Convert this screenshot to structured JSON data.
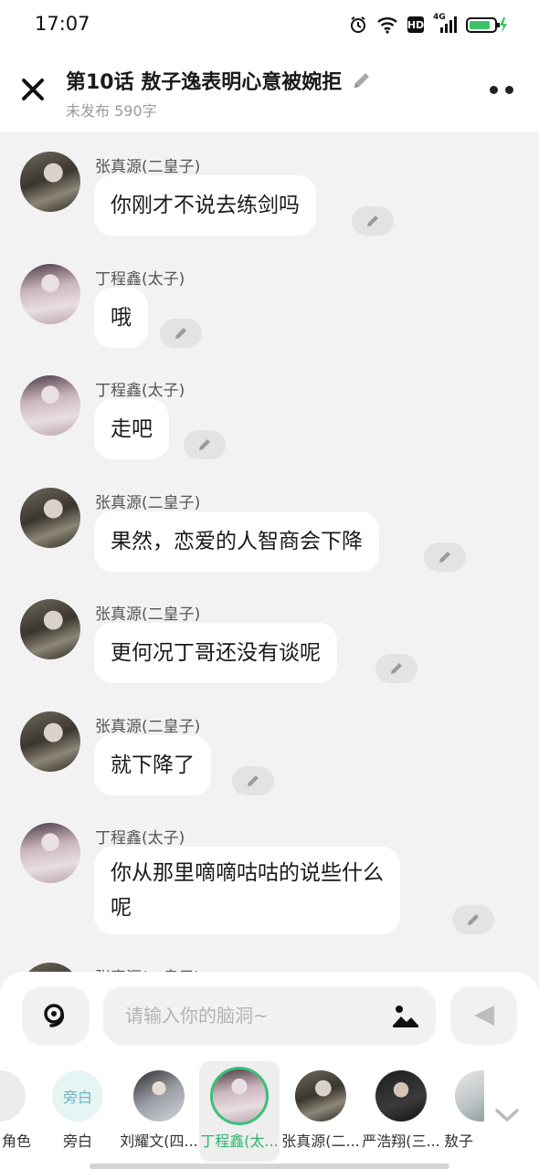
{
  "status_bar": {
    "time": "17:07",
    "network_label": "4G",
    "hd_label": "HD"
  },
  "header": {
    "title": "第10话  敖子逸表明心意被婉拒",
    "subtitle": "未发布 590字"
  },
  "messages": [
    {
      "speaker": "张真源(二皇子)",
      "text": "你刚才不说去练剑吗",
      "avatar": "zhang"
    },
    {
      "speaker": "丁程鑫(太子)",
      "text": "哦",
      "avatar": "ding"
    },
    {
      "speaker": "丁程鑫(太子)",
      "text": "走吧",
      "avatar": "ding"
    },
    {
      "speaker": "张真源(二皇子)",
      "text": "果然，恋爱的人智商会下降",
      "avatar": "zhang"
    },
    {
      "speaker": "张真源(二皇子)",
      "text": "更何况丁哥还没有谈呢",
      "avatar": "zhang"
    },
    {
      "speaker": "张真源(二皇子)",
      "text": "就下降了",
      "avatar": "zhang"
    },
    {
      "speaker": "丁程鑫(太子)",
      "text_line1": "你从那里嘀嘀咕咕的说些什么",
      "text_line2": "呢",
      "avatar": "ding"
    },
    {
      "speaker": "张真源(二皇子)",
      "avatar": "zhang"
    }
  ],
  "composer": {
    "placeholder": "请输入你的脑洞~"
  },
  "roles": [
    {
      "label": "角色",
      "avatar": "partial"
    },
    {
      "label": "旁白",
      "avatar_text": "旁白"
    },
    {
      "label": "刘耀文(四...",
      "avatar": "liu"
    },
    {
      "label": "丁程鑫(太...",
      "avatar": "ding",
      "selected": true
    },
    {
      "label": "张真源(二...",
      "avatar": "zhang"
    },
    {
      "label": "严浩翔(三...",
      "avatar": "yan"
    },
    {
      "label": "敖子",
      "avatar": "ao"
    }
  ],
  "colors": {
    "accent": "#2fb36c",
    "chat_bg": "#f2f2f2",
    "bubble": "#ffffff"
  },
  "icons": [
    "close-icon",
    "edit-icon",
    "more-icon",
    "voice-icon",
    "image-icon",
    "send-icon",
    "chevron-down-icon",
    "alarm-icon",
    "wifi-icon",
    "signal-icon",
    "battery-icon"
  ]
}
